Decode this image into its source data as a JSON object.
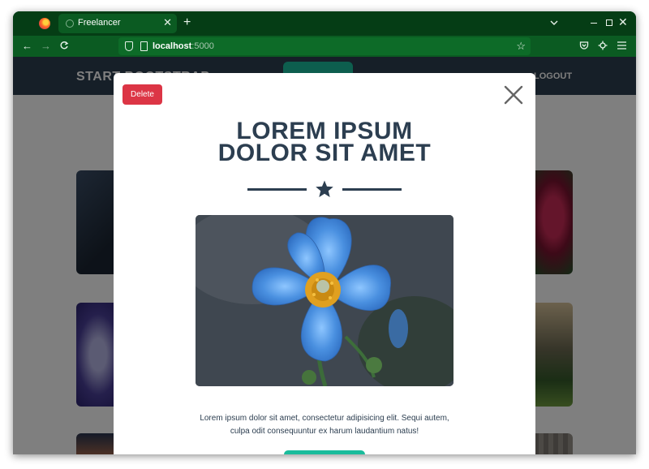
{
  "browser": {
    "tab_title": "Freelancer",
    "tab_close_glyph": "✕",
    "new_tab_glyph": "+",
    "url_host": "localhost",
    "url_port": ":5000",
    "icons": [
      "firefox-logo-icon",
      "tab-favicon-icon",
      "close-icon",
      "new-tab-icon",
      "list-all-tabs-icon",
      "minimize-icon",
      "maximize-icon",
      "close-window-icon",
      "back-arrow-icon",
      "forward-arrow-icon",
      "reload-icon",
      "shield-icon",
      "page-icon",
      "bookmark-star-icon",
      "pocket-icon",
      "extensions-icon",
      "menu-icon"
    ]
  },
  "site": {
    "brand": "START BOOTSTRAP",
    "nav_right": "LOGOUT",
    "accent_color": "#1abc9c",
    "nav_color": "#2c3e50"
  },
  "modal": {
    "delete_label": "Delete",
    "title_line1": "LOREM IPSUM",
    "title_line2": "DOLOR SIT AMET",
    "image_subject": "blue poppy flower",
    "body_text": "Lorem ipsum dolor sit amet, consectetur adipisicing elit. Sequi autem, culpa odit consequuntur ex harum laudantium natus!",
    "delete_color": "#dc3545",
    "title_color": "#2c3e50"
  }
}
